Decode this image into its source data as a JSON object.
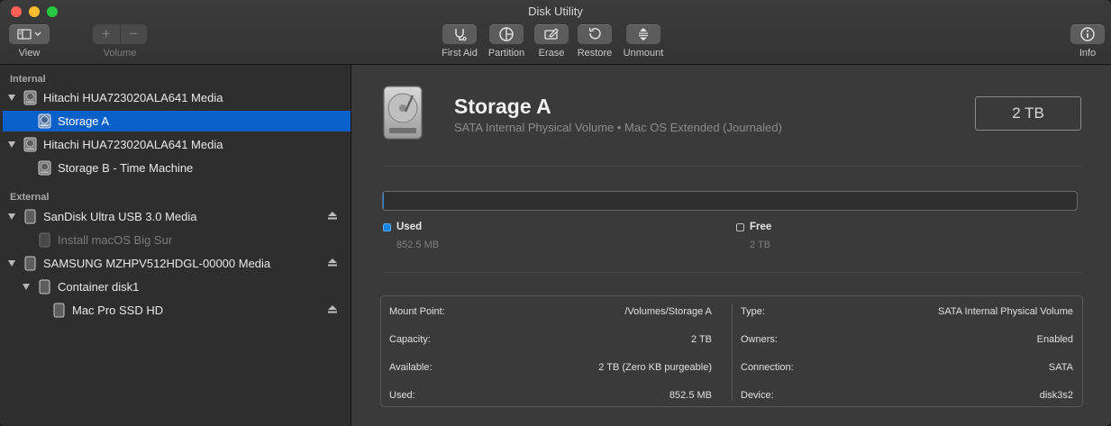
{
  "window": {
    "title": "Disk Utility"
  },
  "toolbar": {
    "view_label": "View",
    "volume_label": "Volume",
    "volume_add": "+",
    "volume_remove": "−",
    "first_aid_label": "First Aid",
    "partition_label": "Partition",
    "erase_label": "Erase",
    "restore_label": "Restore",
    "unmount_label": "Unmount",
    "info_label": "Info"
  },
  "sidebar": {
    "internal_label": "Internal",
    "external_label": "External",
    "items": [
      {
        "label": "Hitachi HUA723020ALA641 Media",
        "type": "disk"
      },
      {
        "label": "Storage A",
        "type": "volume",
        "selected": true
      },
      {
        "label": "Hitachi HUA723020ALA641 Media",
        "type": "disk"
      },
      {
        "label": "Storage B - Time Machine",
        "type": "volume"
      },
      {
        "label": "SanDisk Ultra USB 3.0 Media",
        "type": "disk",
        "ejectable": true
      },
      {
        "label": "Install macOS Big Sur",
        "type": "volume",
        "dimmed": true
      },
      {
        "label": "SAMSUNG MZHPV512HDGL-00000 Media",
        "type": "disk",
        "ejectable": true
      },
      {
        "label": "Container disk1",
        "type": "container"
      },
      {
        "label": "Mac Pro SSD HD",
        "type": "volume",
        "ejectable": true
      }
    ]
  },
  "volume": {
    "name": "Storage A",
    "subtitle": "SATA Internal Physical Volume • Mac OS Extended (Journaled)",
    "size": "2 TB",
    "used_fraction": 0.0004
  },
  "usage": {
    "used_label": "Used",
    "used_value": "852.5 MB",
    "free_label": "Free",
    "free_value": "2 TB",
    "used_color": "#1a86e3"
  },
  "info": {
    "left": [
      {
        "key": "Mount Point:",
        "value": "/Volumes/Storage A"
      },
      {
        "key": "Capacity:",
        "value": "2 TB"
      },
      {
        "key": "Available:",
        "value": "2 TB (Zero KB purgeable)"
      },
      {
        "key": "Used:",
        "value": "852.5 MB"
      }
    ],
    "right": [
      {
        "key": "Type:",
        "value": "SATA Internal Physical Volume"
      },
      {
        "key": "Owners:",
        "value": "Enabled"
      },
      {
        "key": "Connection:",
        "value": "SATA"
      },
      {
        "key": "Device:",
        "value": "disk3s2"
      }
    ]
  }
}
